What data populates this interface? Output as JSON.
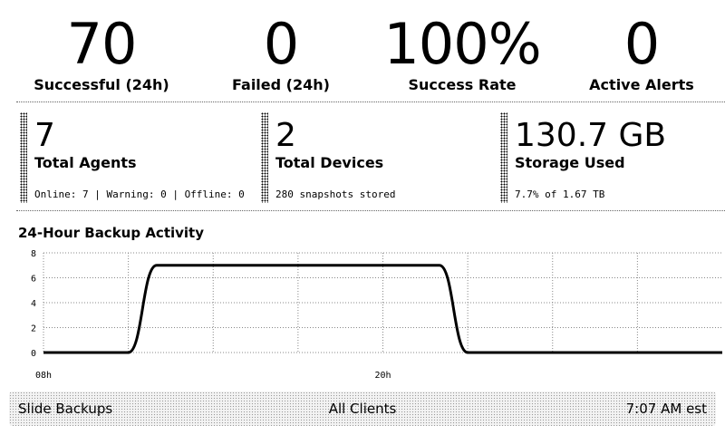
{
  "top_stats": [
    {
      "value": "70",
      "label": "Successful (24h)"
    },
    {
      "value": "0",
      "label": "Failed (24h)"
    },
    {
      "value": "100%",
      "label": "Success Rate"
    },
    {
      "value": "0",
      "label": "Active Alerts"
    }
  ],
  "cards": [
    {
      "value": "7",
      "label": "Total Agents",
      "sub": "Online: 7 | Warning: 0 | Offline: 0"
    },
    {
      "value": "2",
      "label": "Total Devices",
      "sub": "280 snapshots stored"
    },
    {
      "value": "130.7 GB",
      "label": "Storage Used",
      "sub": "7.7% of 1.67 TB"
    }
  ],
  "chart_title": "24-Hour Backup Activity",
  "chart_data": {
    "type": "area",
    "title": "24-Hour Backup Activity",
    "xlabel": "",
    "ylabel": "",
    "x_ticks": [
      "08h",
      "20h"
    ],
    "x_range_hours": [
      8,
      32
    ],
    "ylim": [
      0,
      8
    ],
    "y_ticks": [
      0,
      2,
      4,
      6,
      8
    ],
    "grid": true,
    "x": [
      8,
      9,
      10,
      11,
      12,
      13,
      14,
      15,
      16,
      17,
      18,
      19,
      20,
      21,
      22,
      23,
      24,
      25,
      26,
      27,
      28,
      29,
      30,
      31,
      32
    ],
    "values": [
      0,
      0,
      0,
      0,
      7,
      7,
      7,
      7,
      7,
      7,
      7,
      7,
      7,
      7,
      7,
      0,
      0,
      0,
      0,
      0,
      0,
      0,
      0,
      0,
      0
    ]
  },
  "footer": {
    "left": "Slide Backups",
    "center": "All Clients",
    "right": "7:07 AM est"
  }
}
